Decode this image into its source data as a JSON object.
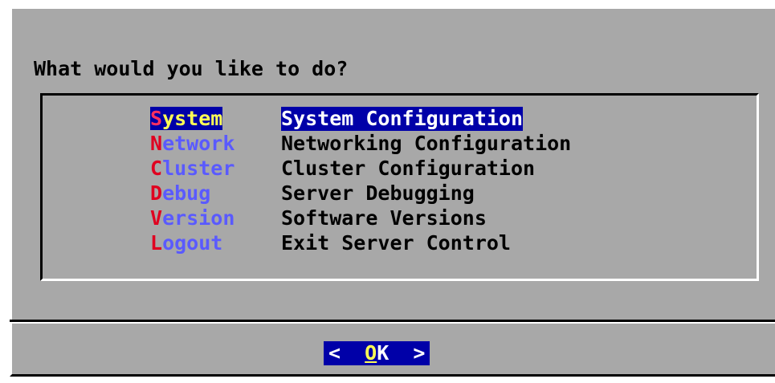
{
  "dialog": {
    "prompt": "What would you like to do?",
    "menu": [
      {
        "hotkey": "S",
        "tag_rest": "ystem",
        "description": "System Configuration",
        "selected": true
      },
      {
        "hotkey": "N",
        "tag_rest": "etwork",
        "description": "Networking Configuration",
        "selected": false
      },
      {
        "hotkey": "C",
        "tag_rest": "luster",
        "description": "Cluster Configuration",
        "selected": false
      },
      {
        "hotkey": "D",
        "tag_rest": "ebug",
        "description": "Server Debugging",
        "selected": false
      },
      {
        "hotkey": "V",
        "tag_rest": "ersion",
        "description": "Software Versions",
        "selected": false
      },
      {
        "hotkey": "L",
        "tag_rest": "ogout",
        "description": "Exit Server Control",
        "selected": false
      }
    ],
    "ok_button": {
      "left_arrow": "<",
      "hotkey": "O",
      "label_rest": "K",
      "right_arrow": ">"
    }
  },
  "colors": {
    "background": "#a8a8a8",
    "selection": "#0000a8",
    "hotkey": "#e00020",
    "tag": "#5a5aff",
    "selected_tag": "#ffff55"
  }
}
